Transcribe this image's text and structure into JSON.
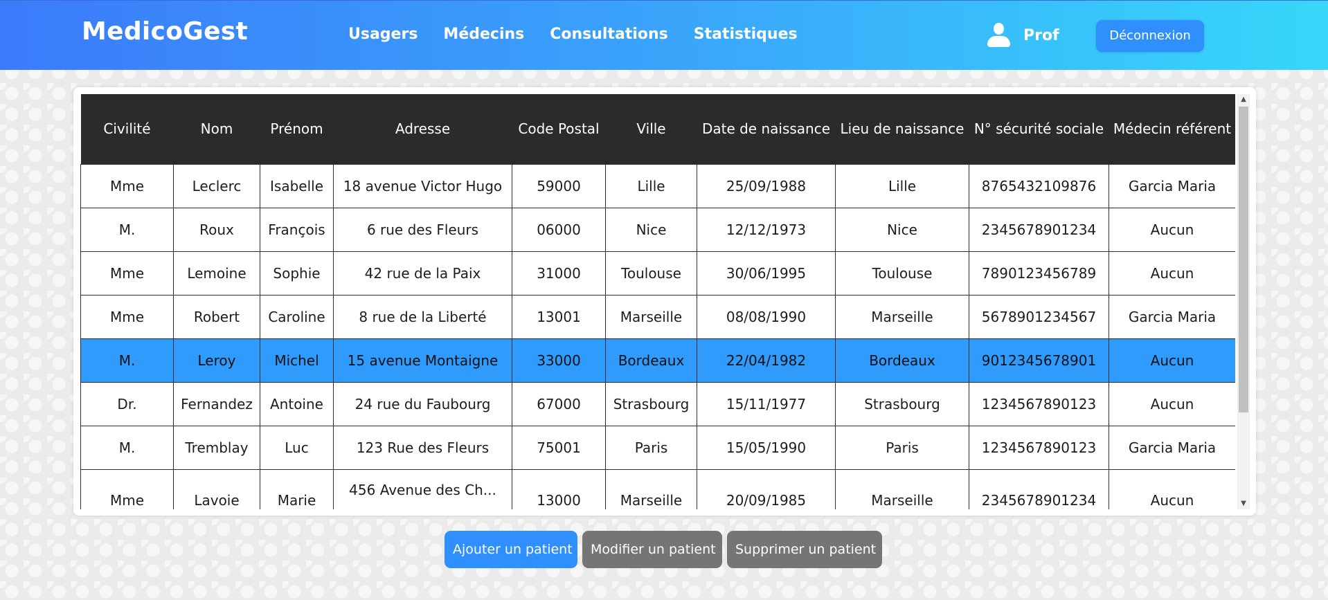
{
  "header": {
    "brand": "MedicoGest",
    "nav": [
      "Usagers",
      "Médecins",
      "Consultations",
      "Statistiques"
    ],
    "user": "Prof",
    "logout_label": "Déconnexion"
  },
  "table": {
    "columns": [
      "Civilité",
      "Nom",
      "Prénom",
      "Adresse",
      "Code Postal",
      "Ville",
      "Date de naissance",
      "Lieu de naissance",
      "N° sécurité sociale",
      "Médecin référent"
    ],
    "rows": [
      [
        "Mme",
        "Leclerc",
        "Isabelle",
        "18 avenue Victor Hugo",
        "59000",
        "Lille",
        "25/09/1988",
        "Lille",
        "8765432109876",
        "Garcia Maria"
      ],
      [
        "M.",
        "Roux",
        "François",
        "6 rue des Fleurs",
        "06000",
        "Nice",
        "12/12/1973",
        "Nice",
        "2345678901234",
        "Aucun"
      ],
      [
        "Mme",
        "Lemoine",
        "Sophie",
        "42 rue de la Paix",
        "31000",
        "Toulouse",
        "30/06/1995",
        "Toulouse",
        "7890123456789",
        "Aucun"
      ],
      [
        "Mme",
        "Robert",
        "Caroline",
        "8 rue de la Liberté",
        "13001",
        "Marseille",
        "08/08/1990",
        "Marseille",
        "5678901234567",
        "Garcia Maria"
      ],
      [
        "M.",
        "Leroy",
        "Michel",
        "15 avenue Montaigne",
        "33000",
        "Bordeaux",
        "22/04/1982",
        "Bordeaux",
        "9012345678901",
        "Aucun"
      ],
      [
        "Dr.",
        "Fernandez",
        "Antoine",
        "24 rue du Faubourg",
        "67000",
        "Strasbourg",
        "15/11/1977",
        "Strasbourg",
        "1234567890123",
        "Aucun"
      ],
      [
        "M.",
        "Tremblay",
        "Luc",
        "123 Rue des Fleurs",
        "75001",
        "Paris",
        "15/05/1990",
        "Paris",
        "1234567890123",
        "Garcia Maria"
      ],
      [
        "Mme",
        "Lavoie",
        "Marie",
        "456 Avenue des Ch...",
        "13000",
        "Marseille",
        "20/09/1985",
        "Marseille",
        "2345678901234",
        "Aucun"
      ]
    ],
    "selected_row": 4
  },
  "actions": {
    "add": "Ajouter un patient",
    "edit": "Modifier un patient",
    "delete": "Supprimer un patient"
  },
  "colors": {
    "accent": "#2f8ffc",
    "selected_row": "#2f9bfc",
    "header_dark": "#2b2b2b",
    "button_gray": "#757575"
  }
}
